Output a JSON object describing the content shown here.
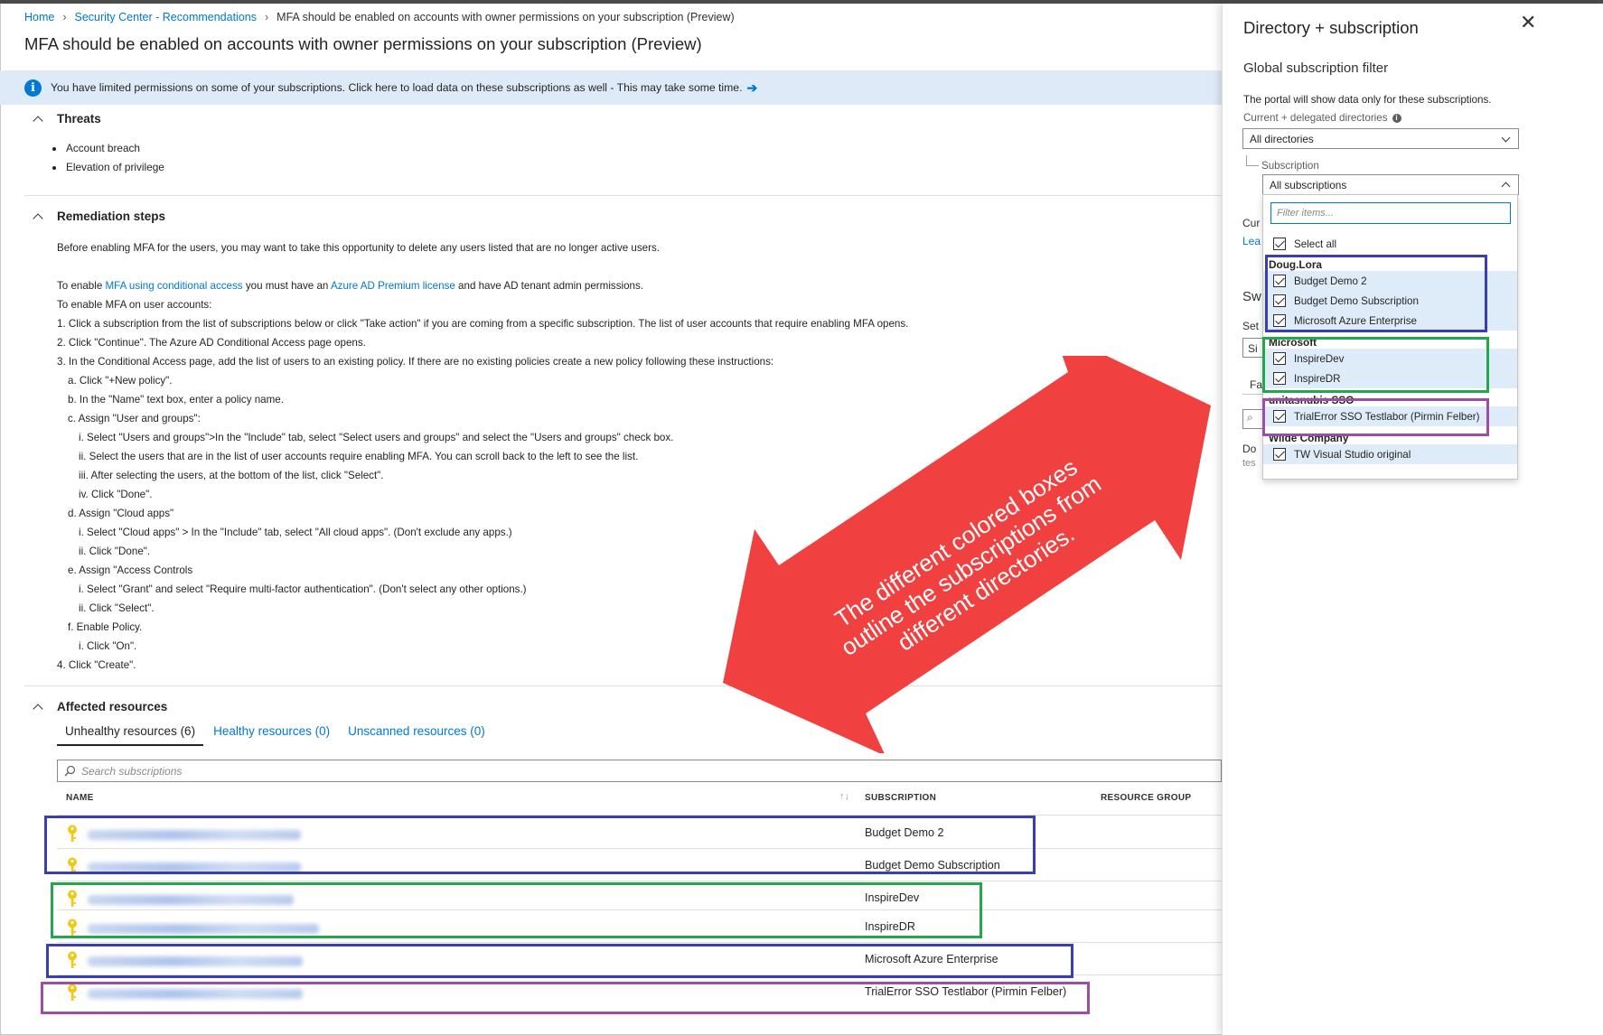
{
  "breadcrumb": {
    "home": "Home",
    "security": "Security Center - Recommendations",
    "current": "MFA should be enabled on accounts with owner permissions on your subscription (Preview)"
  },
  "page_title": "MFA should be enabled on accounts with owner permissions on your subscription (Preview)",
  "infobar": {
    "text": "You have limited permissions on some of your subscriptions. Click here to load data on these subscriptions as well - This may take some time.",
    "arrow": "➔"
  },
  "threats": {
    "title": "Threats",
    "items": [
      "Account breach",
      "Elevation of privilege"
    ]
  },
  "remediation": {
    "title": "Remediation steps",
    "intro": "Before enabling MFA for the users, you may want to take this opportunity to delete any users listed that are no longer active users.",
    "enable_prefix": "To enable ",
    "enable_link1": "MFA using conditional access",
    "enable_mid": " you must have an ",
    "enable_link2": "Azure AD Premium license",
    "enable_suffix": " and have AD tenant admin permissions.",
    "lines": [
      {
        "text": "To enable MFA on user accounts:",
        "indent": 0
      },
      {
        "text": "1. Click a subscription from the list of subscriptions below or click \"Take action\" if you are coming from a specific subscription. The list of user accounts that require enabling MFA opens.",
        "indent": 0
      },
      {
        "text": "2. Click \"Continue\". The Azure AD Conditional Access page opens.",
        "indent": 0
      },
      {
        "text": "3. In the Conditional Access page, add the list of users to an existing policy. If there are no existing policies create a new policy following these instructions:",
        "indent": 0
      },
      {
        "text": "a. Click \"+New policy\".",
        "indent": 1
      },
      {
        "text": "b. In the \"Name\" text box, enter a policy name.",
        "indent": 1
      },
      {
        "text": "c. Assign \"User and groups\":",
        "indent": 1
      },
      {
        "text": "i. Select \"Users and groups\">In the \"Include\" tab, select \"Select users and groups\" and select the \"Users and groups\" check box.",
        "indent": 2
      },
      {
        "text": "ii. Select the users that are in the list of user accounts require enabling MFA. You can scroll back to the left to see the list.",
        "indent": 2
      },
      {
        "text": "iii. After selecting the users, at the bottom of the list, click \"Select\".",
        "indent": 2
      },
      {
        "text": "iv. Click \"Done\".",
        "indent": 2
      },
      {
        "text": "d. Assign \"Cloud apps\"",
        "indent": 1
      },
      {
        "text": "i. Select \"Cloud apps\" > In the \"Include\" tab, select \"All cloud apps\". (Don't exclude any apps.)",
        "indent": 2
      },
      {
        "text": "ii. Click \"Done\".",
        "indent": 2
      },
      {
        "text": "e. Assign \"Access Controls",
        "indent": 1
      },
      {
        "text": "i. Select \"Grant\" and select \"Require multi-factor authentication\". (Don't select any other options.)",
        "indent": 2
      },
      {
        "text": "ii. Click \"Select\".",
        "indent": 2
      },
      {
        "text": "f. Enable Policy.",
        "indent": 1
      },
      {
        "text": "i. Click \"On\".",
        "indent": 2
      },
      {
        "text": "4. Click \"Create\".",
        "indent": 0
      }
    ]
  },
  "affected": {
    "title": "Affected resources",
    "tabs": [
      "Unhealthy resources (6)",
      "Healthy resources (0)",
      "Unscanned resources (0)"
    ],
    "search_placeholder": "Search subscriptions",
    "columns": {
      "name": "NAME",
      "sort": "↑↓",
      "subscription": "SUBSCRIPTION",
      "resource_group": "RESOURCE GROUP"
    },
    "rows": [
      {
        "subscription": "Budget Demo 2"
      },
      {
        "subscription": "Budget Demo Subscription"
      },
      {
        "subscription": "InspireDev"
      },
      {
        "subscription": "InspireDR"
      },
      {
        "subscription": "Microsoft Azure Enterprise"
      },
      {
        "subscription": "TrialError SSO Testlabor (Pirmin Felber)"
      }
    ]
  },
  "annotation": {
    "text_line1": "The different colored boxes",
    "text_line2": "outline the subscriptions from",
    "text_line3": "different directories.",
    "color": "#f0403f"
  },
  "blade": {
    "title": "Directory + subscription",
    "close": "✕",
    "subtitle": "Global subscription filter",
    "desc": "The portal will show data only for these subscriptions.",
    "directories_label": "Current + delegated directories",
    "directories_value": "All directories",
    "subscription_label": "Subscription",
    "subscription_value": "All subscriptions",
    "filter_placeholder": "Filter items...",
    "select_all": "Select all",
    "groups": [
      {
        "name": "Doug.Lora",
        "items": [
          "Budget Demo 2",
          "Budget Demo Subscription",
          "Microsoft Azure Enterprise"
        ]
      },
      {
        "name": "Microsoft",
        "items": [
          "InspireDev",
          "InspireDR"
        ]
      },
      {
        "name": "unitasnubis SSO",
        "items": [
          "TrialError SSO Testlabor (Pirmin Felber)"
        ]
      },
      {
        "name": "Wilde Company",
        "items": [
          "TW Visual Studio original"
        ]
      }
    ],
    "hidden_fragments": {
      "cur": "Cur",
      "lea": "Lea",
      "sw": "Sw",
      "set": "Set",
      "si": "Si",
      "fa": "Fa",
      "do": "Do",
      "tes": "tes"
    }
  },
  "colors": {
    "accent": "#0078d4",
    "blue_box": "#3a3fb0",
    "green_box": "#22a84a",
    "purple_box": "#9b4ea3",
    "key": "#f2c811"
  }
}
